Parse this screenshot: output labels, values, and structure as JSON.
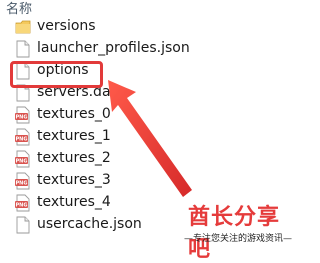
{
  "header": {
    "name_label": "名称"
  },
  "files": [
    {
      "name": "versions",
      "icon": "folder-icon"
    },
    {
      "name": "launcher_profiles.json",
      "icon": "file-icon"
    },
    {
      "name": "options",
      "icon": "file-icon"
    },
    {
      "name": "servers.dat",
      "icon": "file-icon"
    },
    {
      "name": "textures_0",
      "icon": "png-icon"
    },
    {
      "name": "textures_1",
      "icon": "png-icon"
    },
    {
      "name": "textures_2",
      "icon": "png-icon"
    },
    {
      "name": "textures_3",
      "icon": "png-icon"
    },
    {
      "name": "textures_4",
      "icon": "png-icon"
    },
    {
      "name": "usercache.json",
      "icon": "file-icon"
    }
  ],
  "watermark": {
    "brand": "酋长分享吧",
    "tagline": "—专注您关注的游戏资讯—"
  },
  "colors": {
    "highlight": "#e23a3a",
    "folder": "#f4c95d",
    "png_badge": "#d9534f"
  }
}
